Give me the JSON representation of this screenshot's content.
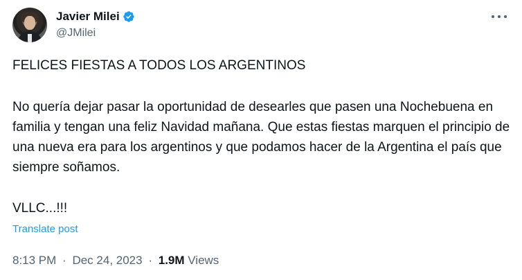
{
  "author": {
    "display_name": "Javier Milei",
    "handle": "@JMilei"
  },
  "tweet": {
    "line1": "FELICES FIESTAS A TODOS LOS ARGENTINOS",
    "paragraph2": "No quería dejar pasar la oportunidad de desearles que pasen una Nochebuena en familia y tengan una feliz Navidad mañana. Que estas fiestas marquen el principio de una nueva era para los argentinos y que podamos hacer de la Argentina el país que siempre soñamos.",
    "paragraph3": "VLLC...!!!"
  },
  "translate_label": "Translate post",
  "meta": {
    "time": "8:13 PM",
    "separator": "·",
    "date": "Dec 24, 2023",
    "separator2": "·",
    "views_count": "1.9M",
    "views_label": "Views"
  },
  "colors": {
    "accent": "#1d9bf0",
    "text": "#0f1419",
    "secondary": "#536471"
  },
  "icons": {
    "verified": "verified-badge-icon",
    "more": "more-horizontal-icon"
  }
}
